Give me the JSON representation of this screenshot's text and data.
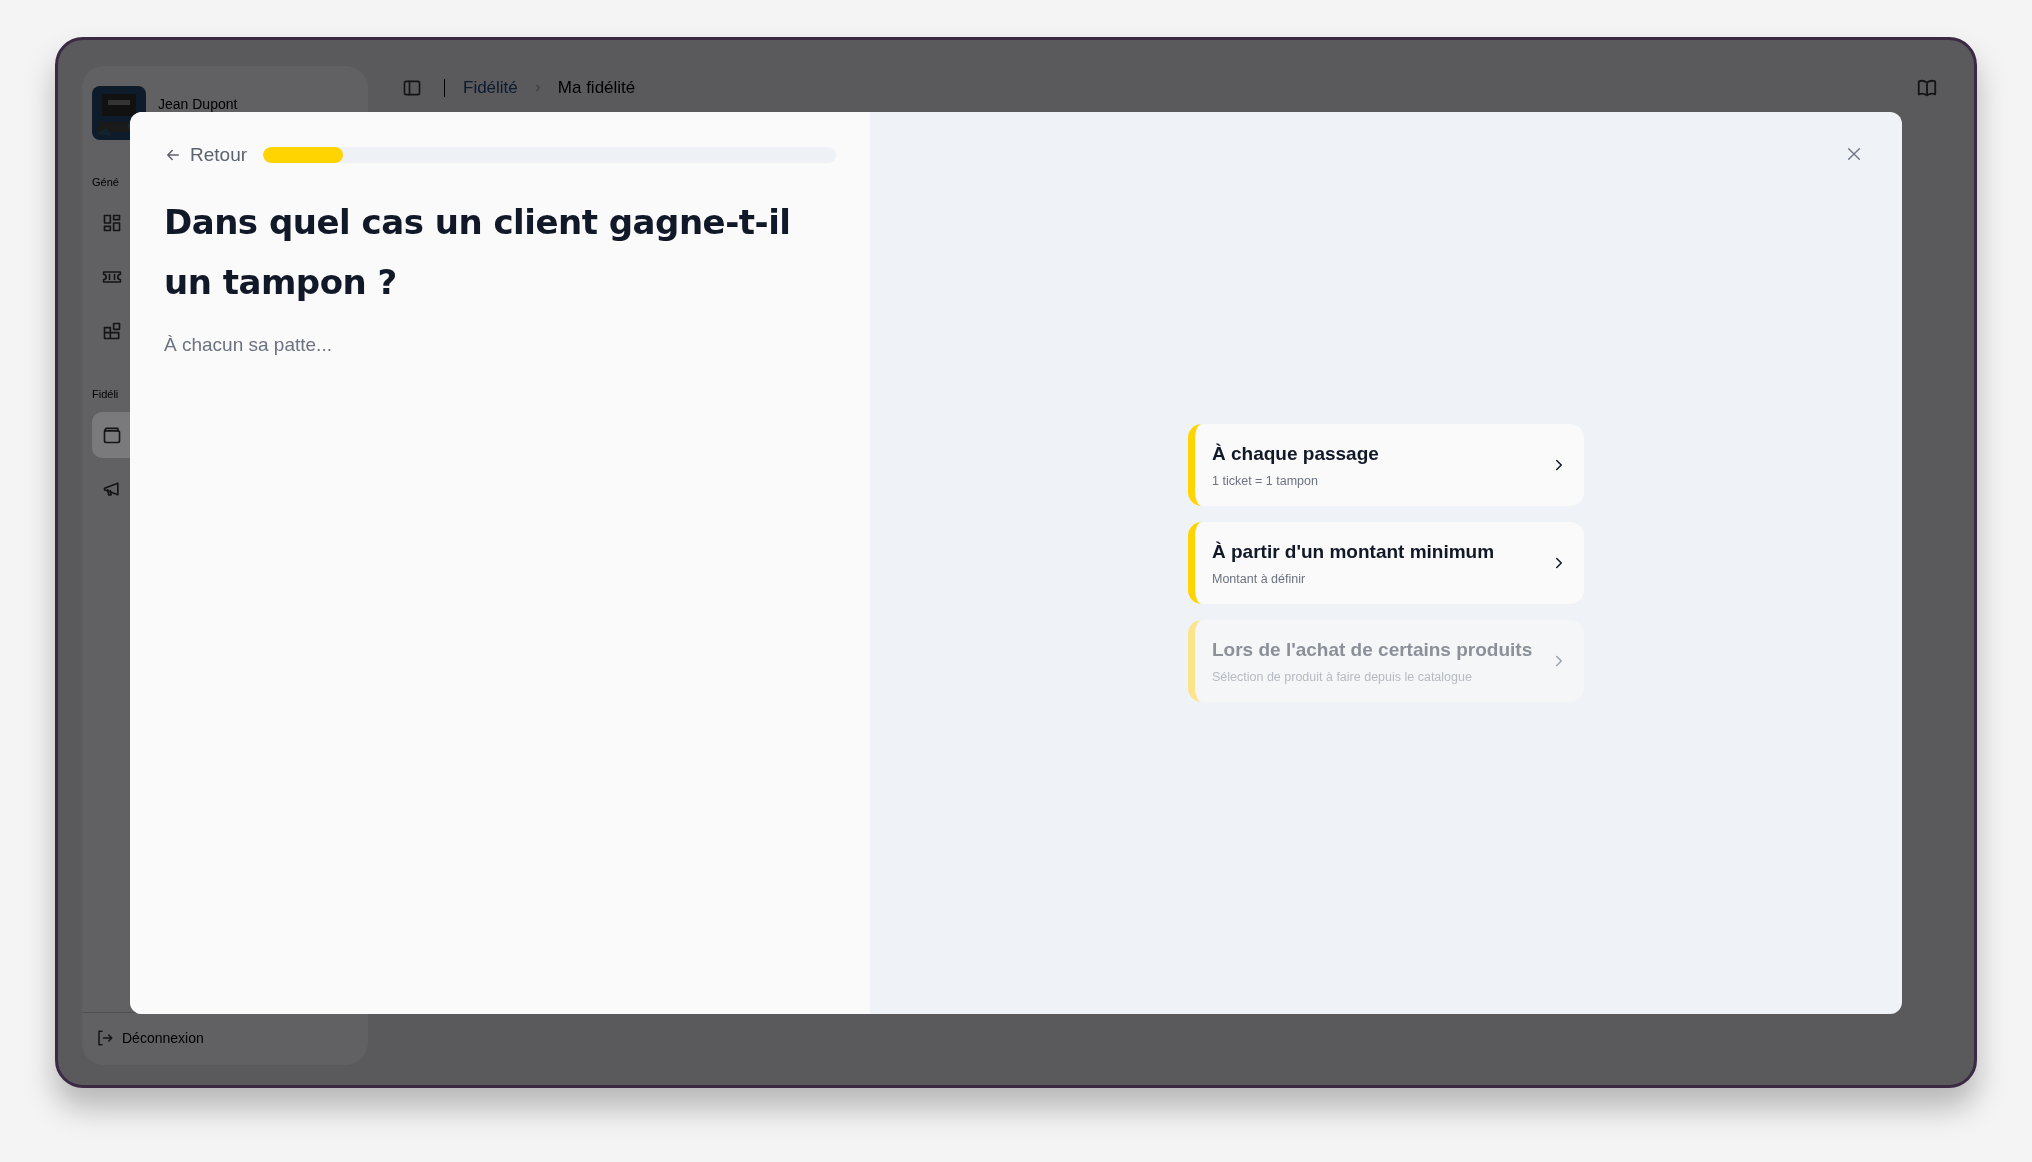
{
  "sidebar": {
    "user": {
      "name": "Jean Dupont"
    },
    "sections": [
      {
        "label": "Géné",
        "items": [
          {
            "kind": "grid",
            "selected": false
          },
          {
            "kind": "ticket",
            "selected": false
          },
          {
            "kind": "blocks",
            "selected": false
          }
        ]
      },
      {
        "label": "Fidéli",
        "items": [
          {
            "kind": "wallet",
            "selected": true
          },
          {
            "kind": "megaphone",
            "selected": false
          }
        ]
      }
    ],
    "logout": "Déconnexion"
  },
  "header": {
    "breadcrumb": [
      "Fidélité",
      "Ma fidélité"
    ]
  },
  "modal": {
    "back": "Retour",
    "progress": {
      "level": 0.14
    },
    "title": "Dans quel cas un client gagne-t-il un tampon ?",
    "subtitle": "À chacun sa patte...",
    "options": [
      {
        "title": "À chaque passage",
        "subtitle": "1 ticket = 1 tampon",
        "disabled": false
      },
      {
        "title": "À partir d'un montant minimum",
        "subtitle": "Montant à définir",
        "disabled": false
      },
      {
        "title": "Lors de l'achat de certains produits",
        "subtitle": "Sélection de produit à faire depuis le catalogue",
        "disabled": true
      }
    ]
  }
}
